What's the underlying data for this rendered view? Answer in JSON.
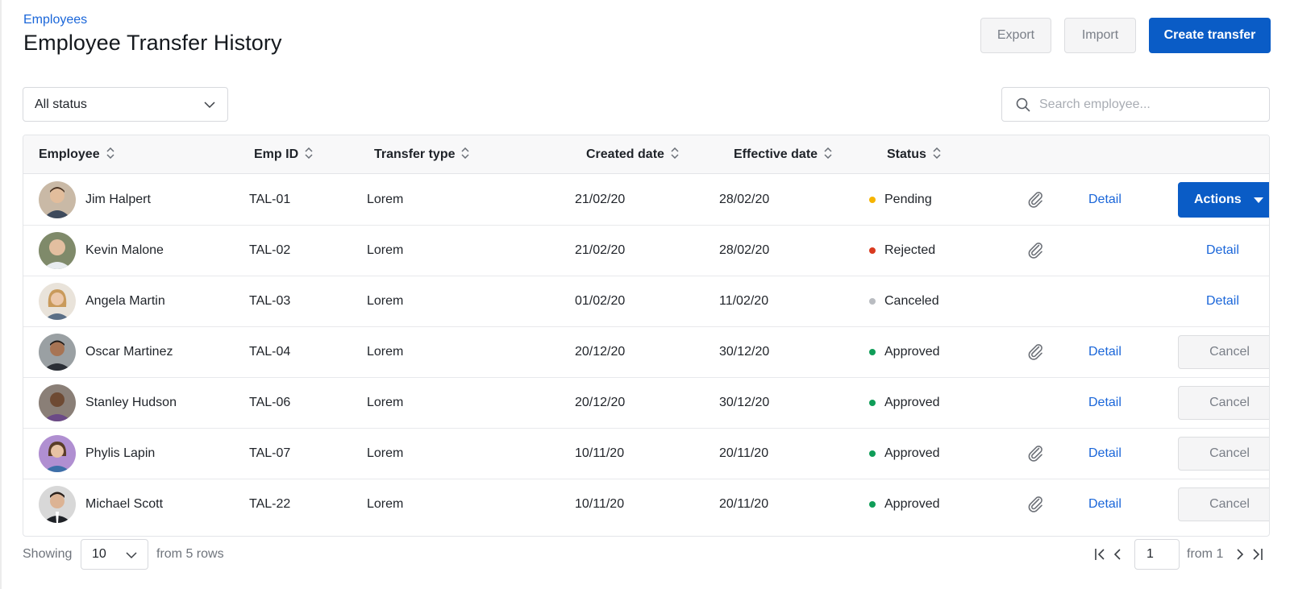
{
  "header": {
    "breadcrumb": "Employees",
    "title": "Employee Transfer History",
    "export_label": "Export",
    "import_label": "Import",
    "create_label": "Create transfer"
  },
  "filters": {
    "status_value": "All status",
    "search_placeholder": "Search employee..."
  },
  "table": {
    "columns": {
      "employee": "Employee",
      "emp_id": "Emp ID",
      "transfer_type": "Transfer type",
      "created_date": "Created date",
      "effective_date": "Effective date",
      "status": "Status"
    },
    "rows": [
      {
        "name": "Jim Halpert",
        "emp_id": "TAL-01",
        "transfer_type": "Lorem",
        "created": "21/02/20",
        "effective": "28/02/20",
        "status": "Pending",
        "status_color": "#f6b400",
        "detail": "Detail",
        "actions_label": "Actions"
      },
      {
        "name": "Kevin Malone",
        "emp_id": "TAL-02",
        "transfer_type": "Lorem",
        "created": "21/02/20",
        "effective": "28/02/20",
        "status": "Rejected",
        "status_color": "#d93a1f",
        "detail": "Detail"
      },
      {
        "name": "Angela Martin",
        "emp_id": "TAL-03",
        "transfer_type": "Lorem",
        "created": "01/02/20",
        "effective": "11/02/20",
        "status": "Canceled",
        "status_color": "#b9bcc1",
        "detail": "Detail"
      },
      {
        "name": "Oscar Martinez",
        "emp_id": "TAL-04",
        "transfer_type": "Lorem",
        "created": "20/12/20",
        "effective": "30/12/20",
        "status": "Approved",
        "status_color": "#0f9d58",
        "detail": "Detail",
        "cancel_label": "Cancel"
      },
      {
        "name": "Stanley Hudson",
        "emp_id": "TAL-06",
        "transfer_type": "Lorem",
        "created": "20/12/20",
        "effective": "30/12/20",
        "status": "Approved",
        "status_color": "#0f9d58",
        "detail": "Detail",
        "cancel_label": "Cancel"
      },
      {
        "name": "Phylis Lapin",
        "emp_id": "TAL-07",
        "transfer_type": "Lorem",
        "created": "10/11/20",
        "effective": "20/11/20",
        "status": "Approved",
        "status_color": "#0f9d58",
        "detail": "Detail",
        "cancel_label": "Cancel"
      },
      {
        "name": "Michael Scott",
        "emp_id": "TAL-22",
        "transfer_type": "Lorem",
        "created": "10/11/20",
        "effective": "20/11/20",
        "status": "Approved",
        "status_color": "#0f9d58",
        "detail": "Detail",
        "cancel_label": "Cancel"
      }
    ]
  },
  "footer": {
    "showing_label": "Showing",
    "page_size": "10",
    "rows_info": "from 5 rows",
    "current_page": "1",
    "pages_info": "from 1"
  },
  "colors": {
    "primary": "#0a5cc6",
    "link": "#1a66d9"
  }
}
